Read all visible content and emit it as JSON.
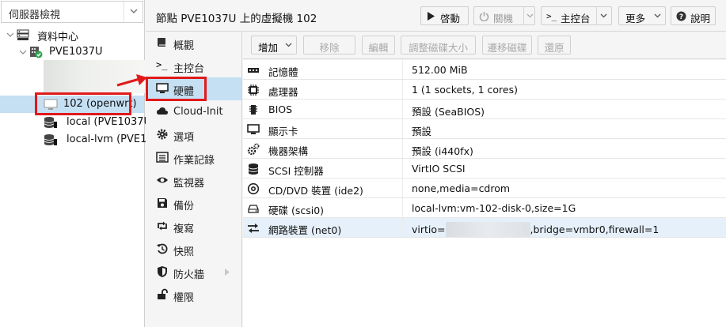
{
  "tree": {
    "view_select": "伺服器檢視",
    "datacenter": "資料中心",
    "node": "PVE1037U",
    "vm": "102 (openwrt)",
    "storage_local": "local (PVE1037U",
    "storage_lvm": "local-lvm (PVE10"
  },
  "header": {
    "title": "節點 PVE1037U 上的虛擬機 102",
    "start": "啓動",
    "shutdown": "關機",
    "console": "主控台",
    "more": "更多",
    "help": "說明"
  },
  "nav": [
    {
      "label": "概觀",
      "icon": "book-icon"
    },
    {
      "label": "主控台",
      "icon": "terminal-icon"
    },
    {
      "label": "硬體",
      "icon": "monitor-icon"
    },
    {
      "label": "Cloud-Init",
      "icon": "cloud-icon"
    },
    {
      "label": "選項",
      "icon": "gear-icon"
    },
    {
      "label": "作業記錄",
      "icon": "list-icon"
    },
    {
      "label": "監視器",
      "icon": "eye-icon"
    },
    {
      "label": "備份",
      "icon": "floppy-icon"
    },
    {
      "label": "複寫",
      "icon": "retweet-icon"
    },
    {
      "label": "快照",
      "icon": "history-icon"
    },
    {
      "label": "防火牆",
      "icon": "shield-icon"
    },
    {
      "label": "權限",
      "icon": "unlock-icon"
    }
  ],
  "toolbar": {
    "add": "增加",
    "remove": "移除",
    "edit": "編輯",
    "resize": "調整磁碟大小",
    "move": "遷移磁碟",
    "revert": "還原"
  },
  "hardware": [
    {
      "key": "記憶體",
      "value": "512.00 MiB",
      "icon": "memory-icon"
    },
    {
      "key": "處理器",
      "value": "1 (1 sockets, 1 cores)",
      "icon": "cpu-icon"
    },
    {
      "key": "BIOS",
      "value": "預設 (SeaBIOS)",
      "icon": "microchip-icon"
    },
    {
      "key": "顯示卡",
      "value": "預設",
      "icon": "desktop-icon"
    },
    {
      "key": "機器架構",
      "value": "預設 (i440fx)",
      "icon": "cogs-icon"
    },
    {
      "key": "SCSI 控制器",
      "value": "VirtIO SCSI",
      "icon": "database-icon"
    },
    {
      "key": "CD/DVD 裝置 (ide2)",
      "value": "none,media=cdrom",
      "icon": "cdrom-icon"
    },
    {
      "key": "硬碟 (scsi0)",
      "value": "local-lvm:vm-102-disk-0,size=1G",
      "icon": "hdd-icon"
    },
    {
      "key": "網路裝置 (net0)",
      "value_prefix": "virtio=",
      "value_suffix": ",bridge=vmbr0,firewall=1",
      "icon": "exchange-icon"
    }
  ],
  "colors": {
    "selection": "#c5dff3",
    "annotation_red": "#e01a1a",
    "status_green": "#2ea44f"
  }
}
